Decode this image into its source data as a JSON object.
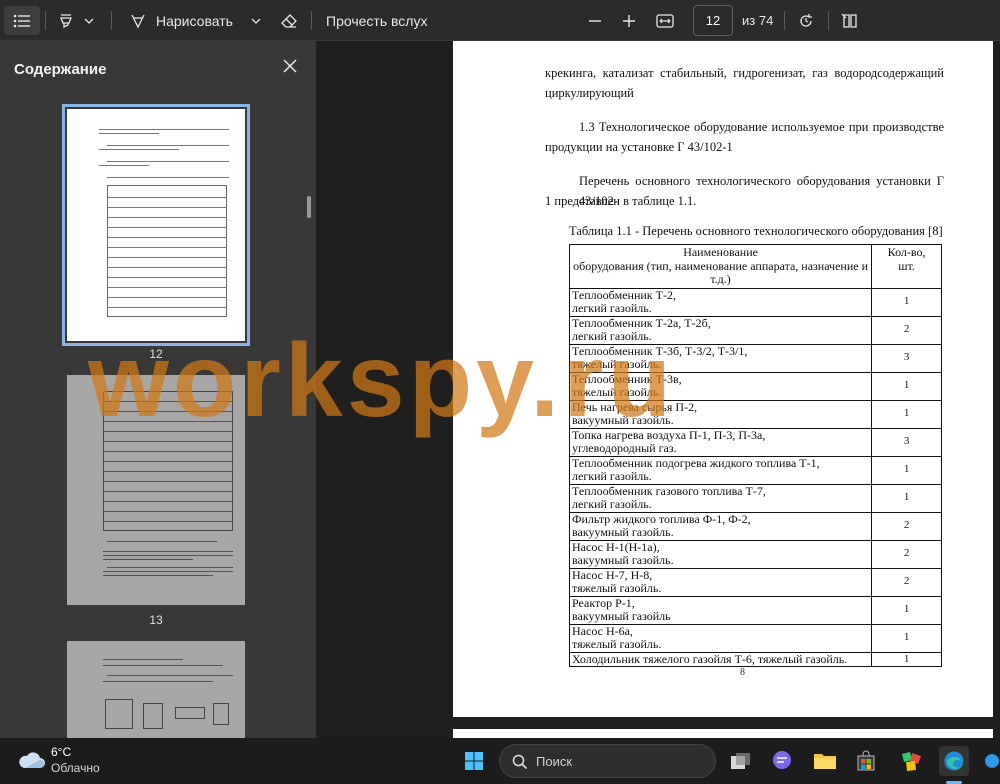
{
  "toolbar": {
    "draw_label": "Нарисовать",
    "read_aloud_label": "Прочесть вслух",
    "page_current": "12",
    "page_total": "из 74"
  },
  "sidebar": {
    "title": "Содержание",
    "thumbnails": [
      {
        "num": "12"
      },
      {
        "num": "13"
      }
    ]
  },
  "document": {
    "para_top_1": "крекинга, катализат стабильный, гидрогенизат, газ водородсодержащий",
    "para_top_2": "циркулирующий",
    "para_13_1": "1.3 Технологическое оборудование используемое при производстве",
    "para_13_2": "продукции на установке Г 43/102-1",
    "para_list_1": "Перечень основного технологического оборудования установки Г 43/102-",
    "para_list_2": "1 представлен в таблице 1.1.",
    "table_caption": "Таблица 1.1 - Перечень основного технологического оборудования [8]",
    "table_header": {
      "name_l1": "Наименование",
      "name_l2": "оборудования (тип, наименование аппарата, назначение и",
      "name_l3": "т.д.)",
      "qty_l1": "Кол-во,",
      "qty_l2": "шт."
    },
    "rows": [
      {
        "l1": "Теплообменник Т-2,",
        "l2": "легкий газойль.",
        "qty": "1"
      },
      {
        "l1": "Теплообменник Т-2а, Т-2б,",
        "l2": "легкий газойль.",
        "qty": "2"
      },
      {
        "l1": "Теплообменник Т-3б, Т-3/2, Т-3/1,",
        "l2": "тяжелый газойль.",
        "qty": "3"
      },
      {
        "l1": "Теплообменник Т-3в,",
        "l2": "тяжелый газойль.",
        "qty": "1"
      },
      {
        "l1": "Печь нагрева сырья П-2,",
        "l2": "вакуумный газойль.",
        "qty": "1"
      },
      {
        "l1": "Топка нагрева воздуха П-1, П-3, П-3а,",
        "l2": "углеводородный газ.",
        "qty": "3"
      },
      {
        "l1": "Теплообменник подогрева жидкого топлива Т-1,",
        "l2": "легкий газойль.",
        "qty": "1"
      },
      {
        "l1": "Теплообменник газового топлива Т-7,",
        "l2": "легкий газойль.",
        "qty": "1"
      },
      {
        "l1": "Фильтр жидкого топлива Ф-1, Ф-2,",
        "l2": "вакуумный газойль.",
        "qty": "2"
      },
      {
        "l1": "Насос Н-1(Н-1а),",
        "l2": "вакуумный газойль.",
        "qty": "2"
      },
      {
        "l1": "Насос Н-7, Н-8,",
        "l2": "тяжелый газойль.",
        "qty": "2"
      },
      {
        "l1": "Реактор Р-1,",
        "l2": "вакуумный газойль",
        "qty": "1"
      },
      {
        "l1": "Насос Н-6а,",
        "l2": "тяжелый газойль.",
        "qty": "1"
      },
      {
        "l1": "Холодильник тяжелого газойля Т-6, тяжелый газойль.",
        "l2": "",
        "qty": "1"
      }
    ],
    "page_number": "8",
    "watermark": "workspy.ru"
  },
  "taskbar": {
    "weather_temp": "6°C",
    "weather_desc": "Облачно",
    "search_label": "Поиск"
  }
}
